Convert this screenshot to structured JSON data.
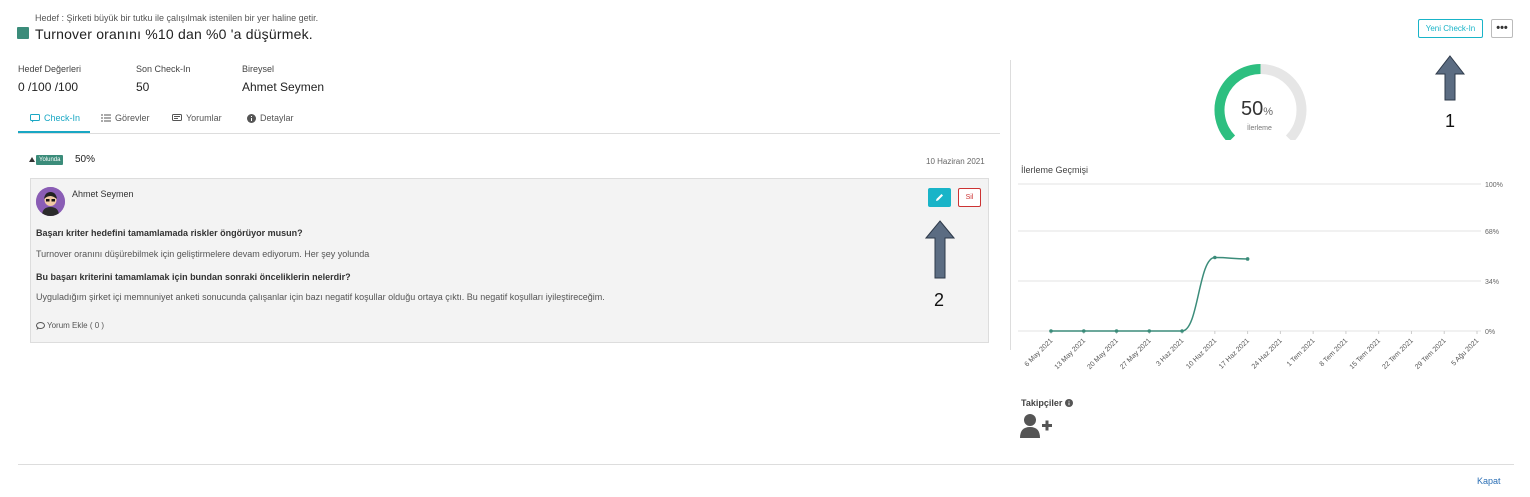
{
  "header": {
    "subtitle": "Hedef : Şirketi büyük bir tutku ile çalışılmak istenilen bir yer haline getir.",
    "title": "Turnover oranını %10 dan %0 'a düşürmek.",
    "checkin_button": "Yeni Check-In",
    "more_button": "•••"
  },
  "stats": [
    {
      "label": "Hedef Değerleri",
      "value": "0 /100 /100"
    },
    {
      "label": "Son Check-In",
      "value": "50"
    },
    {
      "label": "Bireysel",
      "value": "Ahmet Seymen"
    }
  ],
  "tabs": [
    {
      "label": "Check-In",
      "icon": "chat-icon",
      "active": true
    },
    {
      "label": "Görevler",
      "icon": "list-icon",
      "active": false
    },
    {
      "label": "Yorumlar",
      "icon": "comment-icon",
      "active": false
    },
    {
      "label": "Detaylar",
      "icon": "info-icon",
      "active": false
    }
  ],
  "checkin": {
    "badge": "Yolunda",
    "percent": "50%",
    "date": "10 Haziran 2021",
    "author": "Ahmet Seymen",
    "delete_label": "Sil",
    "q1": "Başarı kriter hedefini tamamlamada riskler öngörüyor musun?",
    "a1": "Turnover oranını düşürebilmek için geliştirmelere devam ediyorum. Her şey yolunda",
    "q2": "Bu başarı kriterini tamamlamak için bundan sonraki önceliklerin nelerdir?",
    "a2": "Uyguladığım şirket içi memnuniyet anketi sonucunda çalışanlar için bazı negatif koşullar olduğu ortaya çıktı. Bu negatif koşulları iyileştireceğim.",
    "comment_link": "Yorum Ekle ( 0 )"
  },
  "progress": {
    "value": "50",
    "unit": "%",
    "label": "İlerleme",
    "fraction": 0.5,
    "color": "#2dbf80",
    "track_color": "#e6e6e6"
  },
  "history_title": "İlerleme Geçmişi",
  "chart_data": {
    "type": "line",
    "categories": [
      "6 May 2021",
      "13 May 2021",
      "20 May 2021",
      "27 May 2021",
      "3 Haz 2021",
      "10 Haz 2021",
      "17 Haz 2021",
      "24 Haz 2021",
      "1 Tem 2021",
      "8 Tem 2021",
      "15 Tem 2021",
      "22 Tem 2021",
      "29 Tem 2021",
      "5 Ağu 2021"
    ],
    "series": [
      {
        "values": [
          0,
          0,
          0,
          0,
          0,
          50,
          49
        ]
      }
    ],
    "y_ticks": [
      "0%",
      "34%",
      "68%",
      "100%"
    ],
    "ylim": [
      0,
      100
    ],
    "grid": true,
    "color": "#3b8c7a"
  },
  "followers_title": "Takipçiler",
  "close_link": "Kapat",
  "annotations": [
    "1",
    "2"
  ]
}
